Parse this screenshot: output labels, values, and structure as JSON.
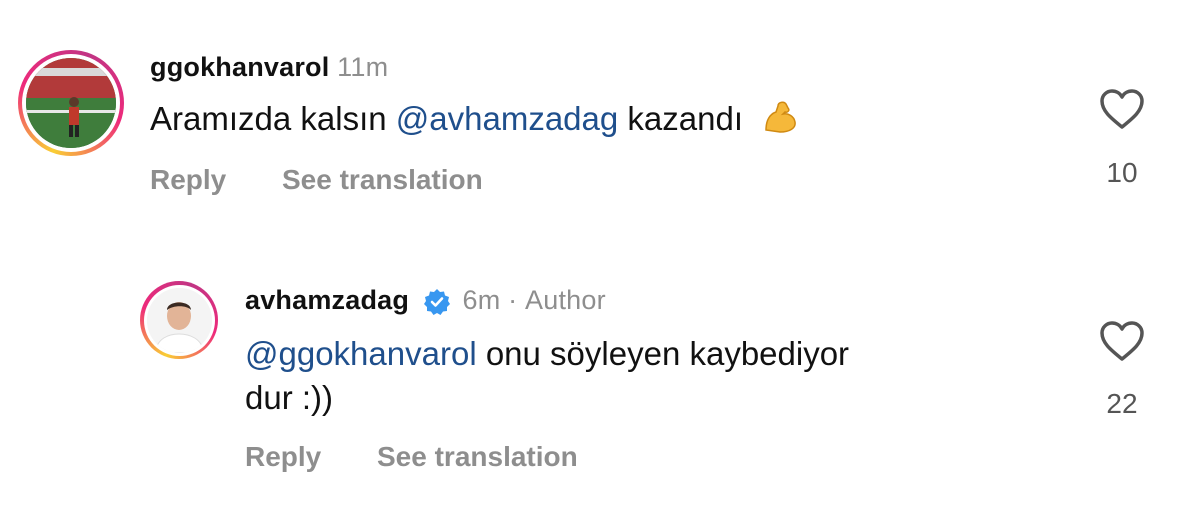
{
  "comments": [
    {
      "username": "ggokhanvarol",
      "time": "11m",
      "author_label": "",
      "verified": false,
      "text_before": "Aramızda kalsın ",
      "mention": "@avhamzadag",
      "text_after": " kazandı",
      "emoji_icon": "flexed-biceps-icon",
      "reply_label": "Reply",
      "translate_label": "See translation",
      "likes": "10"
    },
    {
      "username": "avhamzadag",
      "time": "6m",
      "separator": "·",
      "author_label": "Author",
      "verified": true,
      "mention": "@ggokhanvarol",
      "text_after": " onu söyleyen kaybediyor",
      "text_line2": "dur :))",
      "reply_label": "Reply",
      "translate_label": "See translation",
      "likes": "22"
    }
  ],
  "colors": {
    "mention": "#1f4f8c",
    "muted": "#8e8e8e",
    "verified": "#3897f0"
  }
}
